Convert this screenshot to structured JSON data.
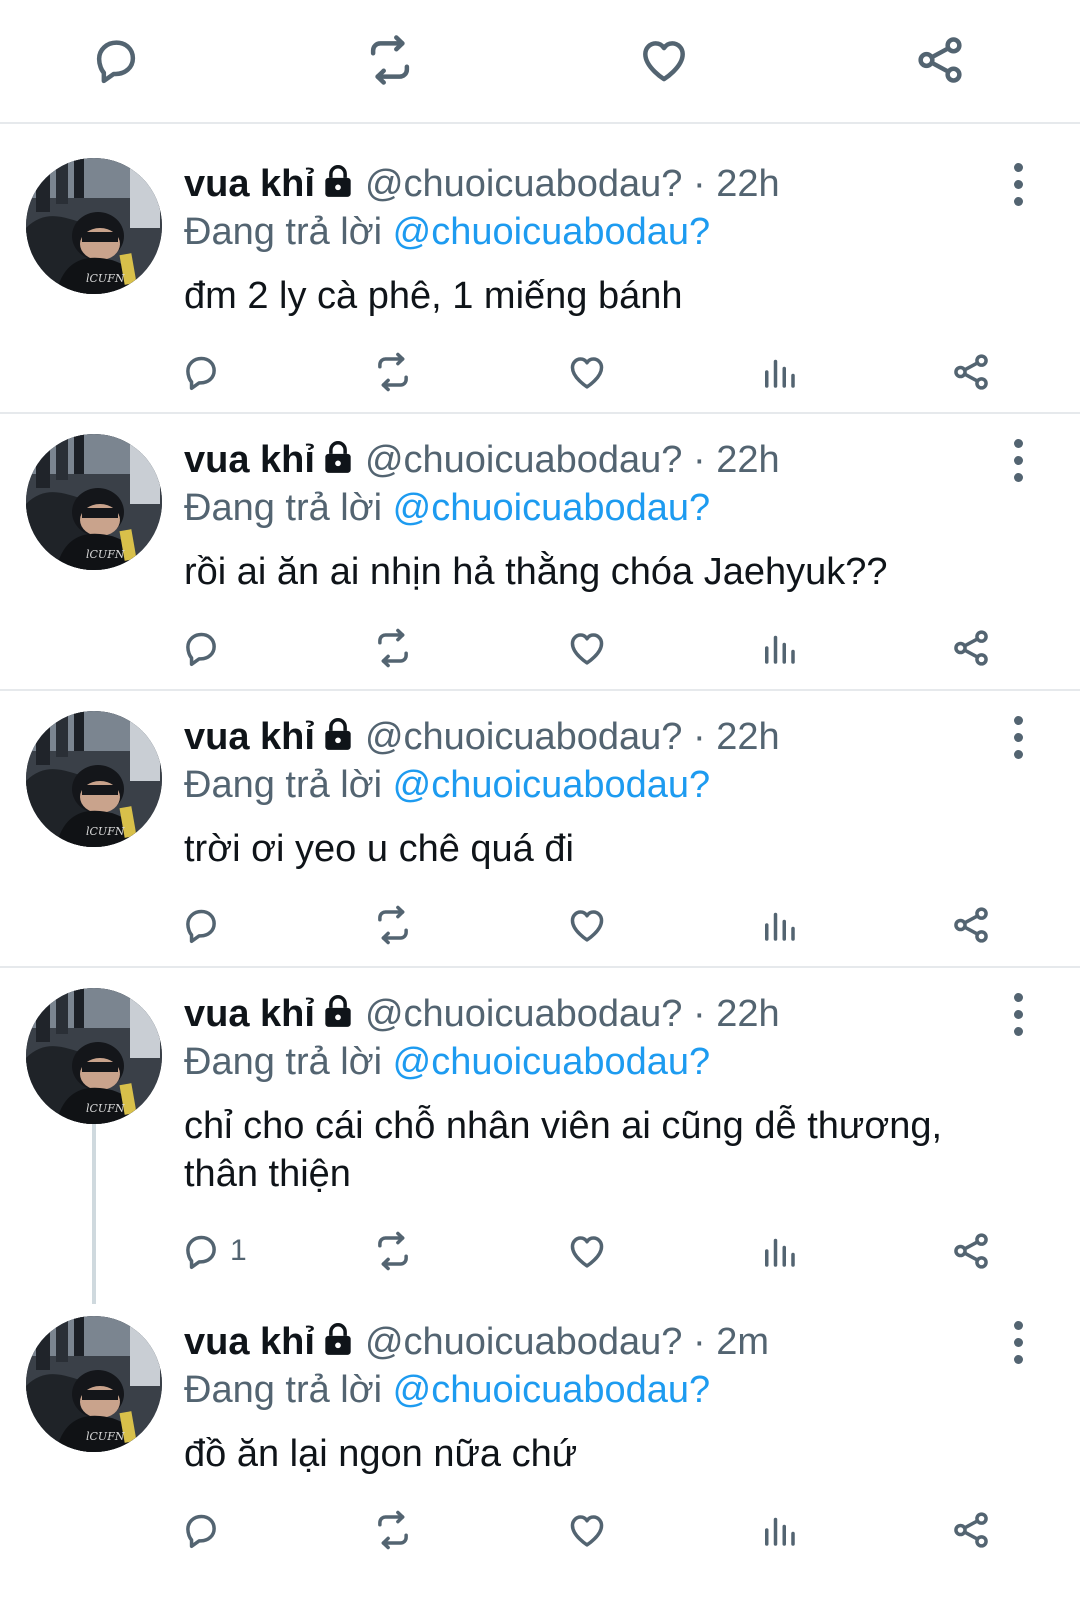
{
  "top_actions": {
    "reply_icon": "reply-icon",
    "retweet_icon": "retweet-icon",
    "like_icon": "heart-icon",
    "share_icon": "share-icon"
  },
  "tweets": [
    {
      "name": "vua khỉ",
      "handle_time": "@chuoicuabodau? · 22h",
      "replying_prefix": "Đang trả lời ",
      "replying_to": "@chuoicuabodau?",
      "text": "đm 2 ly cà phê, 1 miếng bánh",
      "reply_count": ""
    },
    {
      "name": "vua khỉ",
      "handle_time": "@chuoicuabodau? · 22h",
      "replying_prefix": "Đang trả lời ",
      "replying_to": "@chuoicuabodau?",
      "text": "rồi ai ăn ai nhịn hả thằng chóa Jaehyuk??",
      "reply_count": ""
    },
    {
      "name": "vua khỉ",
      "handle_time": "@chuoicuabodau? · 22h",
      "replying_prefix": "Đang trả lời ",
      "replying_to": "@chuoicuabodau?",
      "text": "trời ơi yeo u chê quá đi",
      "reply_count": ""
    },
    {
      "name": "vua khỉ",
      "handle_time": "@chuoicuabodau? · 22h",
      "replying_prefix": "Đang trả lời ",
      "replying_to": "@chuoicuabodau?",
      "text": "chỉ cho cái chỗ nhân viên ai cũng dễ thương, thân thiện",
      "reply_count": "1"
    },
    {
      "name": "vua khỉ",
      "handle_time": "@chuoicuabodau? · 2m",
      "replying_prefix": "Đang trả lời ",
      "replying_to": "@chuoicuabodau?",
      "text": "đồ ăn lại ngon nữa chứ",
      "reply_count": ""
    }
  ],
  "colors": {
    "text": "#0f1419",
    "secondary": "#536471",
    "link": "#1d9bf0",
    "divider": "#e6e9ec"
  }
}
